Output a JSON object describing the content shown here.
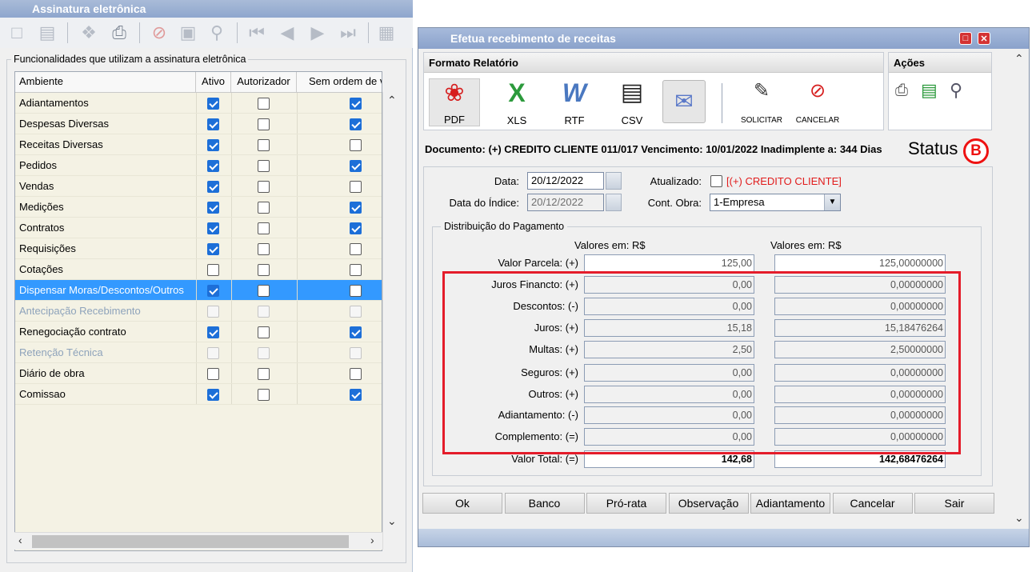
{
  "left_window": {
    "title": "Assinatura eletrônica",
    "toolbar_icons": [
      "new-document-icon",
      "trash-icon",
      "person-run-icon",
      "printer-icon",
      "stop-icon",
      "save-disk-icon",
      "magnifier-icon",
      "first-record-icon",
      "previous-record-icon",
      "next-record-icon",
      "last-record-icon",
      "display-settings-icon"
    ],
    "group_legend": "Funcionalidades que utilizam a assinatura eletrônica",
    "columns": [
      "Ambiente",
      "Ativo",
      "Autorizador",
      "Sem ordem de v"
    ],
    "rows": [
      {
        "ambiente": "Adiantamentos",
        "ativo": true,
        "autorizador": false,
        "sem_ordem": true,
        "disabled": false,
        "selected": false
      },
      {
        "ambiente": "Despesas Diversas",
        "ativo": true,
        "autorizador": false,
        "sem_ordem": true,
        "disabled": false,
        "selected": false
      },
      {
        "ambiente": "Receitas Diversas",
        "ativo": true,
        "autorizador": false,
        "sem_ordem": false,
        "disabled": false,
        "selected": false
      },
      {
        "ambiente": "Pedidos",
        "ativo": true,
        "autorizador": false,
        "sem_ordem": true,
        "disabled": false,
        "selected": false
      },
      {
        "ambiente": "Vendas",
        "ativo": true,
        "autorizador": false,
        "sem_ordem": false,
        "disabled": false,
        "selected": false
      },
      {
        "ambiente": "Medições",
        "ativo": true,
        "autorizador": false,
        "sem_ordem": true,
        "disabled": false,
        "selected": false
      },
      {
        "ambiente": "Contratos",
        "ativo": true,
        "autorizador": false,
        "sem_ordem": true,
        "disabled": false,
        "selected": false
      },
      {
        "ambiente": "Requisições",
        "ativo": true,
        "autorizador": false,
        "sem_ordem": false,
        "disabled": false,
        "selected": false
      },
      {
        "ambiente": "Cotações",
        "ativo": false,
        "autorizador": false,
        "sem_ordem": false,
        "disabled": false,
        "selected": false
      },
      {
        "ambiente": "Dispensar Moras/Descontos/Outros",
        "ativo": true,
        "autorizador": false,
        "sem_ordem": false,
        "disabled": false,
        "selected": true
      },
      {
        "ambiente": "Antecipação Recebimento",
        "ativo": false,
        "autorizador": false,
        "sem_ordem": false,
        "disabled": true,
        "selected": false
      },
      {
        "ambiente": "Renegociação contrato",
        "ativo": true,
        "autorizador": false,
        "sem_ordem": true,
        "disabled": false,
        "selected": false
      },
      {
        "ambiente": "Retenção Técnica",
        "ativo": false,
        "autorizador": false,
        "sem_ordem": false,
        "disabled": true,
        "selected": false
      },
      {
        "ambiente": "Diário de obra",
        "ativo": false,
        "autorizador": false,
        "sem_ordem": false,
        "disabled": false,
        "selected": false
      },
      {
        "ambiente": "Comissao",
        "ativo": true,
        "autorizador": false,
        "sem_ordem": true,
        "disabled": false,
        "selected": false
      }
    ]
  },
  "right_window": {
    "title": "Efetua recebimento de receitas",
    "formato_header": "Formato Relatório",
    "acoes_header": "Ações",
    "formats": [
      {
        "label": "PDF",
        "icon": "pdf-icon"
      },
      {
        "label": "XLS",
        "icon": "excel-icon"
      },
      {
        "label": "RTF",
        "icon": "word-icon"
      },
      {
        "label": "CSV",
        "icon": "csv-document-icon"
      },
      {
        "label": "",
        "icon": "email-envelope-icon"
      }
    ],
    "actions": [
      {
        "label": "SOLICITAR",
        "icon": "request-signature-icon"
      },
      {
        "label": "CANCELAR",
        "icon": "cancel-signature-icon"
      }
    ],
    "acoes_icons": [
      "printer-icon",
      "spreadsheet-export-icon",
      "search-report-icon"
    ],
    "document_line": "Documento: (+) CREDITO CLIENTE 011/017 Vencimento: 10/01/2022 Inadimplente a: 344 Dias",
    "status_label": "Status",
    "status_badge": "B",
    "data_label": "Data:",
    "data_value": "20/12/2022",
    "data_indice_label": "Data do Índice:",
    "data_indice_value": "20/12/2022",
    "atualizado_label": "Atualizado:",
    "atualizado_text": "[(+) CREDITO CLIENTE]",
    "cont_obra_label": "Cont. Obra:",
    "cont_obra_value": "1-Empresa",
    "distribuicao_legend": "Distribuição do Pagamento",
    "valores_em_1": "Valores em: R$",
    "valores_em_2": "Valores em: R$",
    "lines": [
      {
        "label": "Valor Parcela: (+)",
        "v1": "125,00",
        "v2": "125,00000000",
        "style": "white"
      },
      {
        "label": "Juros Financto: (+)",
        "v1": "0,00",
        "v2": "0,00000000",
        "style": "ro"
      },
      {
        "label": "Descontos: (-)",
        "v1": "0,00",
        "v2": "0,00000000",
        "style": "ro"
      },
      {
        "label": "Juros: (+)",
        "v1": "15,18",
        "v2": "15,18476264",
        "style": "ro"
      },
      {
        "label": "Multas: (+)",
        "v1": "2,50",
        "v2": "2,50000000",
        "style": "ro"
      },
      {
        "label": "Seguros: (+)",
        "v1": "0,00",
        "v2": "0,00000000",
        "style": "ro"
      },
      {
        "label": "Outros: (+)",
        "v1": "0,00",
        "v2": "0,00000000",
        "style": "ro"
      },
      {
        "label": "Adiantamento: (-)",
        "v1": "0,00",
        "v2": "0,00000000",
        "style": "ro"
      },
      {
        "label": "Complemento: (=)",
        "v1": "0,00",
        "v2": "0,00000000",
        "style": "ro"
      },
      {
        "label": "Valor Total: (=)",
        "v1": "142,68",
        "v2": "142,68476264",
        "style": "bold"
      }
    ],
    "buttons": [
      "Ok",
      "Banco",
      "Pró-rata",
      "Observação",
      "Adiantamento",
      "Cancelar",
      "Sair"
    ],
    "colors": {
      "highlight": "#e41c2a",
      "selected_row": "#3399ff",
      "atualizado_text": "#e11b1b",
      "title_bar": "#8ea6cd"
    }
  }
}
